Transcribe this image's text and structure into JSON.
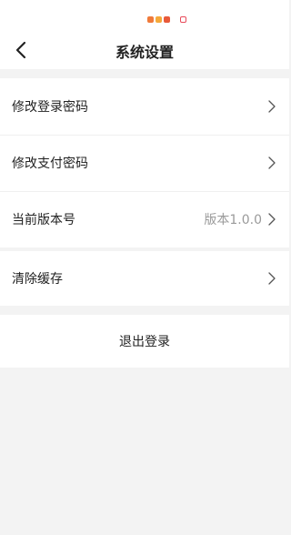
{
  "nav": {
    "title": "系统设置"
  },
  "settings": {
    "items": [
      {
        "label": "修改登录密码",
        "value": ""
      },
      {
        "label": "修改支付密码",
        "value": ""
      },
      {
        "label": "当前版本号",
        "value": "版本1.0.0"
      }
    ],
    "cache": {
      "label": "清除缓存"
    }
  },
  "logout": {
    "label": "退出登录"
  }
}
